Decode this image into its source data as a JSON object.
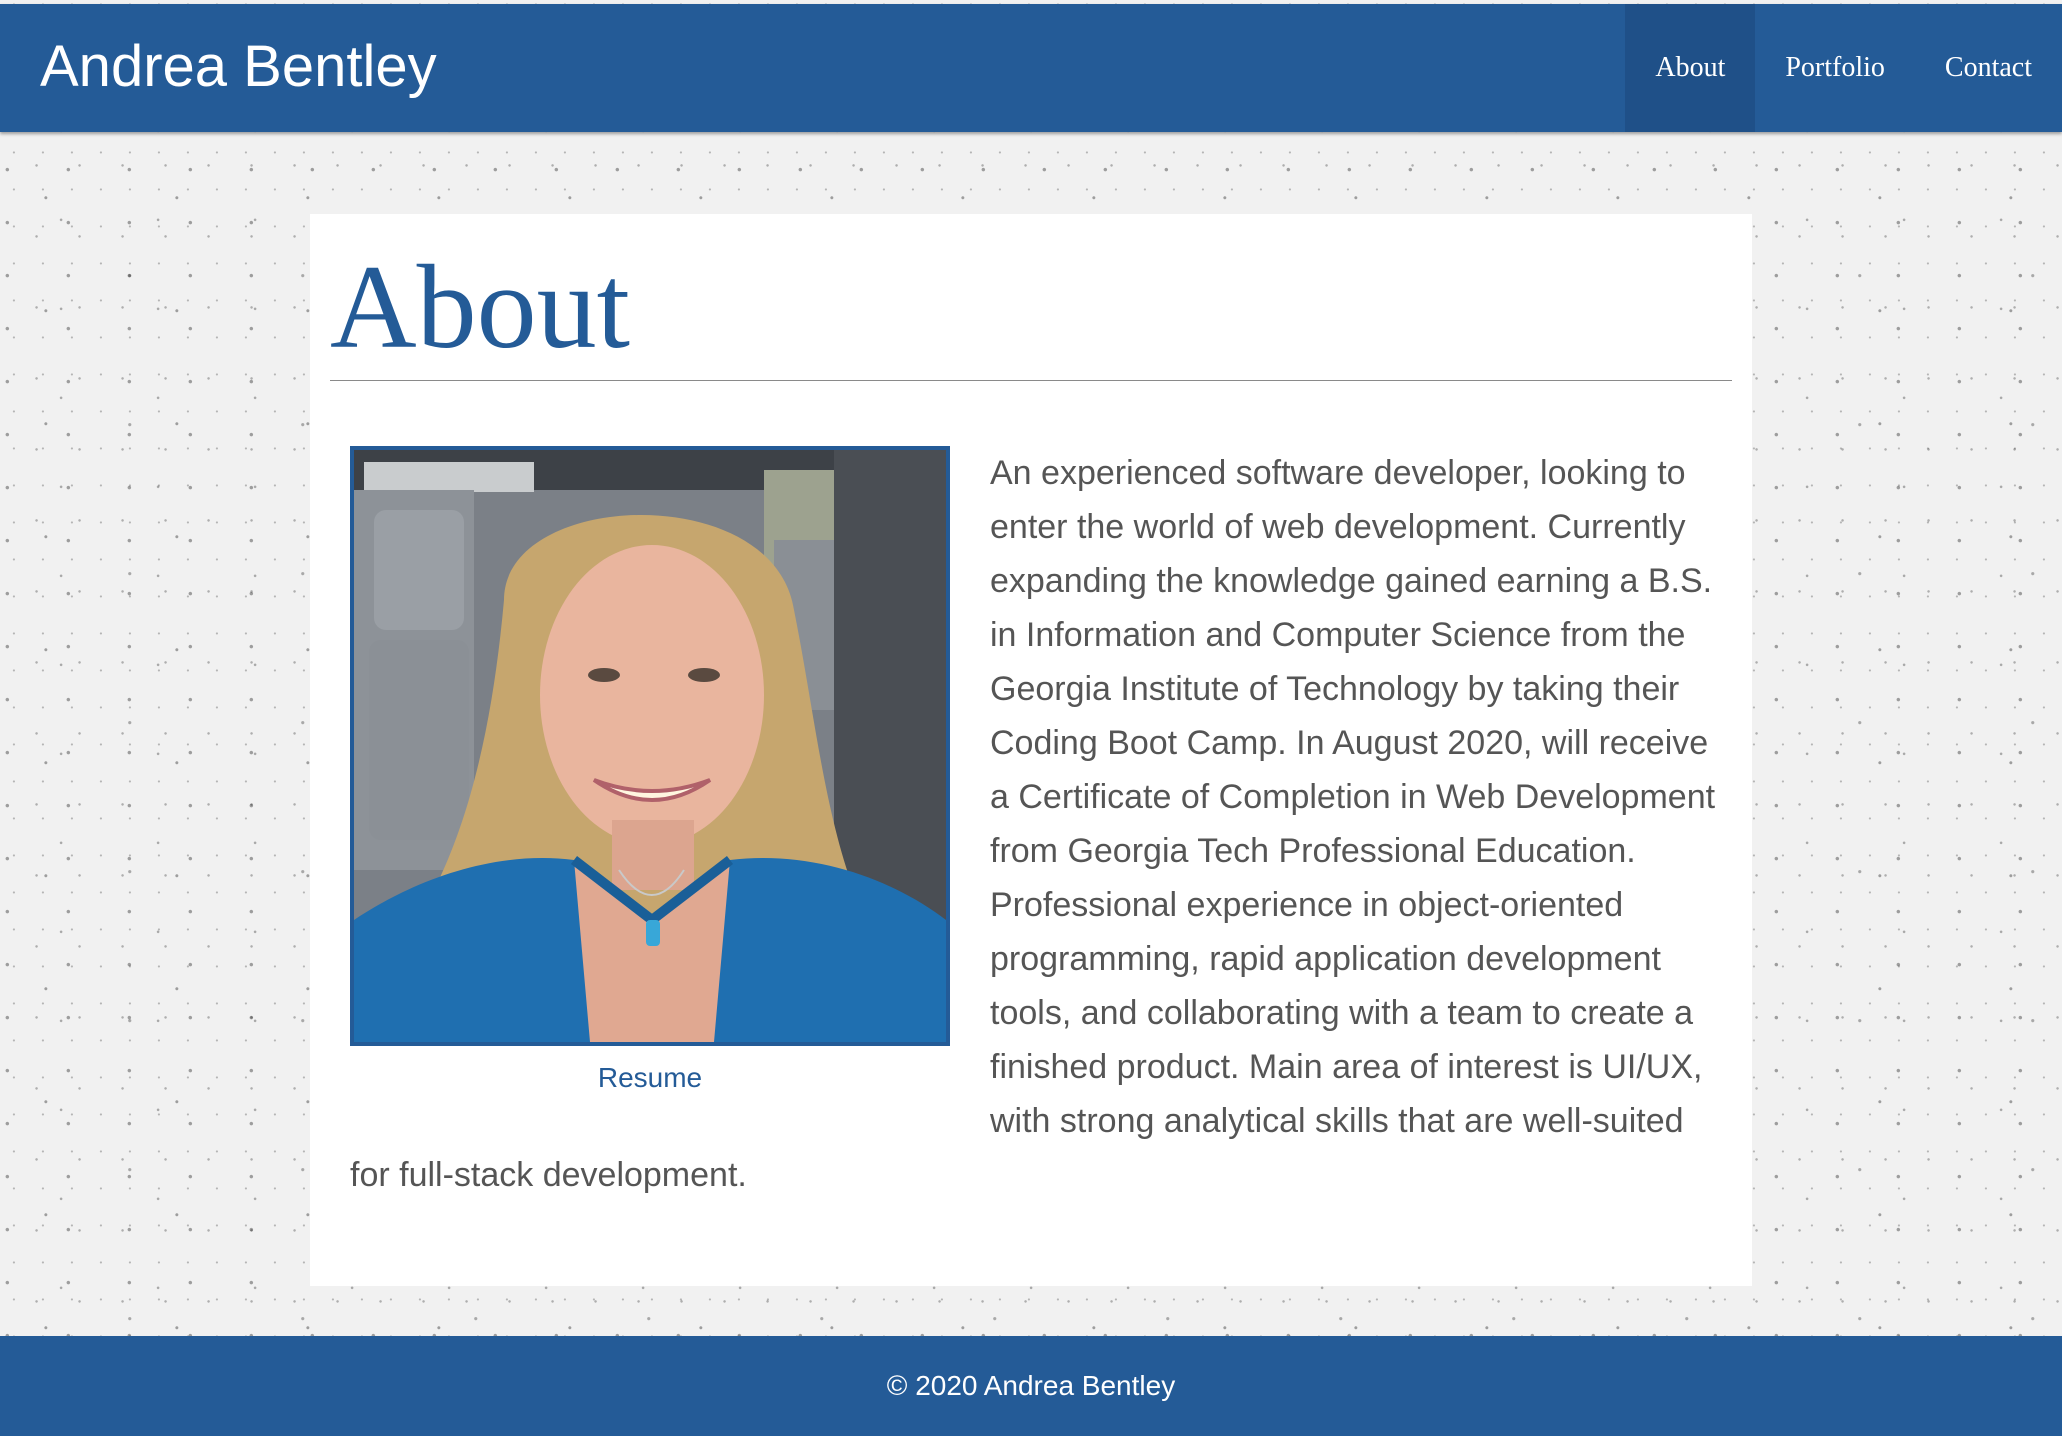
{
  "header": {
    "brand": "Andrea Bentley",
    "nav": [
      {
        "label": "About",
        "active": true
      },
      {
        "label": "Portfolio",
        "active": false
      },
      {
        "label": "Contact",
        "active": false
      }
    ]
  },
  "main": {
    "title": "About",
    "resume_label": "Resume",
    "bio": "An experienced software developer, looking to enter the world of web development. Currently expanding the knowledge gained earning a B.S. in Information and Computer Science from the Georgia Institute of Technology by taking their Coding Boot Camp. In August 2020, will receive a Certificate of Completion in Web Development from Georgia Tech Professional Education. Professional experience in object-oriented programming, rapid application development tools, and collaborating with a team to create a finished product. Main area of interest is UI/UX, with strong analytical skills that are well-suited for full-stack development."
  },
  "footer": {
    "copyright": "© 2020 Andrea Bentley"
  },
  "colors": {
    "primary": "#245b97",
    "nav_active": "#1f5088",
    "text": "#555555",
    "card": "#ffffff",
    "background": "#f1f1f1"
  }
}
